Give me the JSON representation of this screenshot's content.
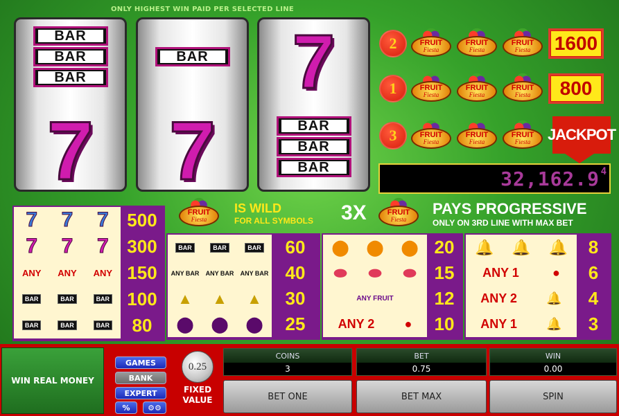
{
  "notice": "ONLY HIGHEST WIN PAID PER SELECTED LINE",
  "reels": [
    {
      "top": "BAR BAR BAR",
      "bottom": "7"
    },
    {
      "top": "BAR",
      "bottom": "7"
    },
    {
      "top": "7",
      "bottom": "BAR BAR BAR"
    }
  ],
  "symbol_text": {
    "bar": "BAR",
    "seven": "7",
    "fruit_line1": "FRUIT",
    "fruit_line2": "Fiesta"
  },
  "paylines": [
    {
      "number": "2",
      "prize": "1600"
    },
    {
      "number": "1",
      "prize": "800"
    },
    {
      "number": "3",
      "prize": "JACKPOT"
    }
  ],
  "progressive": {
    "value": "32,162.9",
    "fraction": "4"
  },
  "wild": {
    "title": "IS WILD",
    "subtitle": "FOR ALL SYMBOLS"
  },
  "progressive_info": {
    "multiplier": "3X",
    "title": "PAYS PROGRESSIVE",
    "subtitle": "ONLY ON 3RD LINE WITH MAX BET"
  },
  "paytable": {
    "col1": [
      {
        "label": "777 rainbow",
        "value": "500"
      },
      {
        "label": "777 magenta",
        "value": "300"
      },
      {
        "label": "ANY",
        "value": "150"
      },
      {
        "label": "BAR BAR BAR",
        "value": "100"
      },
      {
        "label": "BAR BAR",
        "value": "80"
      }
    ],
    "col2": [
      {
        "label": "BAR",
        "value": "60"
      },
      {
        "label": "ANY BAR",
        "value": "40"
      },
      {
        "label": "pineapple",
        "value": "30"
      },
      {
        "label": "plum",
        "value": "25"
      }
    ],
    "col3": [
      {
        "label": "orange",
        "value": "20"
      },
      {
        "label": "watermelon",
        "value": "15"
      },
      {
        "label": "ANY FRUIT",
        "value": "12"
      },
      {
        "label": "ANY 2",
        "value": "10"
      }
    ],
    "col4": [
      {
        "label": "bell",
        "value": "8"
      },
      {
        "label": "ANY 1",
        "value": "6"
      },
      {
        "label": "ANY 2",
        "value": "4"
      },
      {
        "label": "ANY 1",
        "value": "3"
      }
    ],
    "any": "ANY",
    "any_fruit_line1": "ANY",
    "any_fruit_line2": "FRUIT",
    "any1": "ANY 1",
    "any2": "ANY 2"
  },
  "controls": {
    "win_real_money": "WIN REAL MONEY",
    "games": "GAMES",
    "bank": "BANK",
    "expert": "EXPERT",
    "percent": "%",
    "coin_value": "0.25",
    "fixed_value_line1": "FIXED",
    "fixed_value_line2": "VALUE",
    "coins_label": "COINS",
    "coins_value": "3",
    "bet_label": "BET",
    "bet_value": "0.75",
    "win_label": "WIN",
    "win_value": "0.00",
    "bet_one": "BET ONE",
    "bet_max": "BET MAX",
    "spin": "SPIN"
  },
  "colors": {
    "background": "#35a12a",
    "accent": "#d81c0c",
    "prize_yellow": "#ffe81a",
    "paytable_purple": "#7a1a8a"
  }
}
